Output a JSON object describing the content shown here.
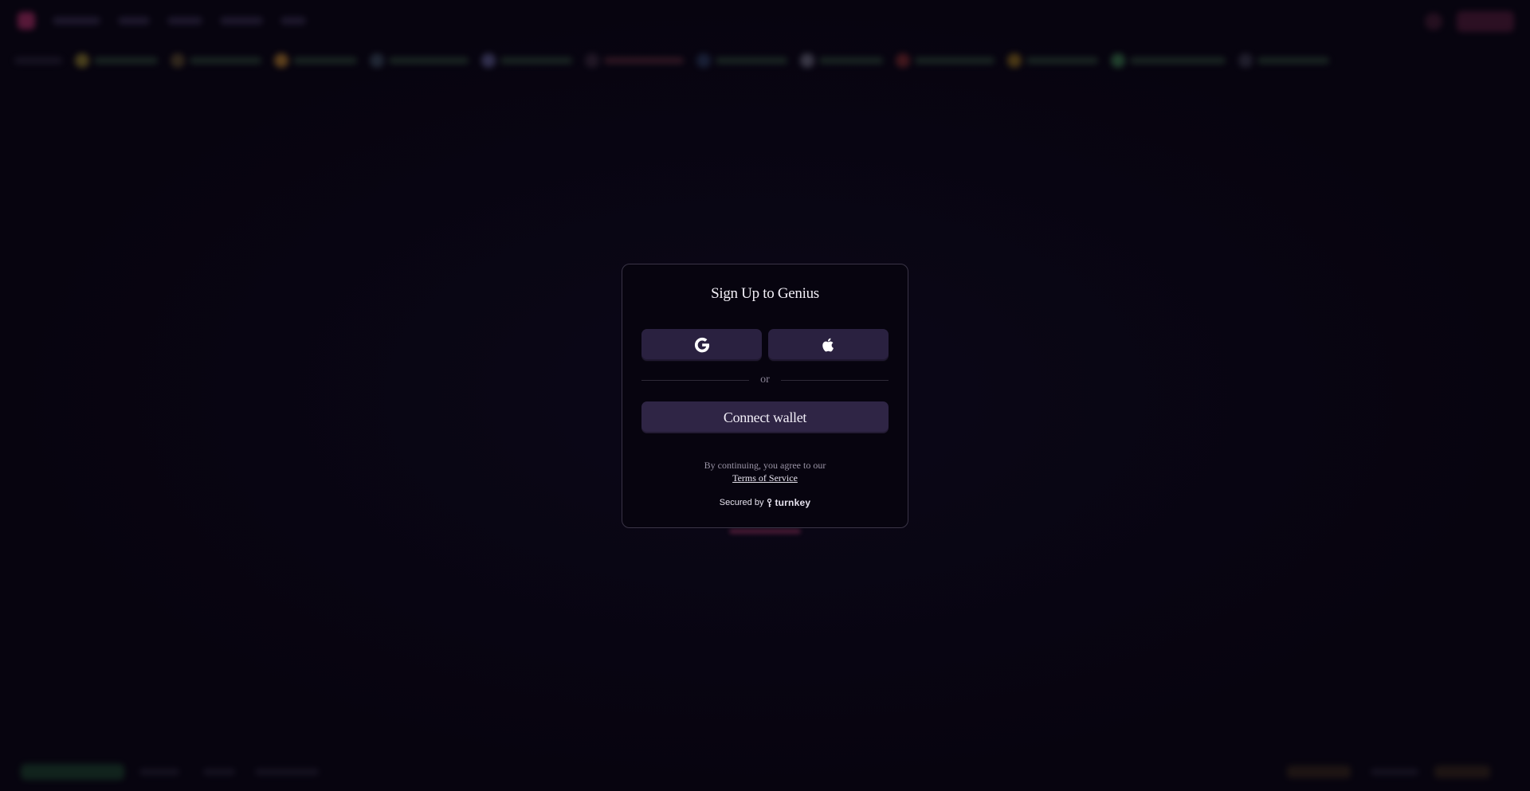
{
  "modal": {
    "title": "Sign Up to Genius",
    "google_button": {
      "icon": "google-icon"
    },
    "apple_button": {
      "icon": "apple-icon"
    },
    "divider_text": "or",
    "connect_wallet_label": "Connect wallet",
    "terms_prefix": "By continuing, you agree to our",
    "terms_link": "Terms of Service",
    "secured_by": "Secured by",
    "secured_brand": "turnkey"
  },
  "colors": {
    "background": "#07040f",
    "button": "#2a2140",
    "accent": "#b8326b"
  }
}
